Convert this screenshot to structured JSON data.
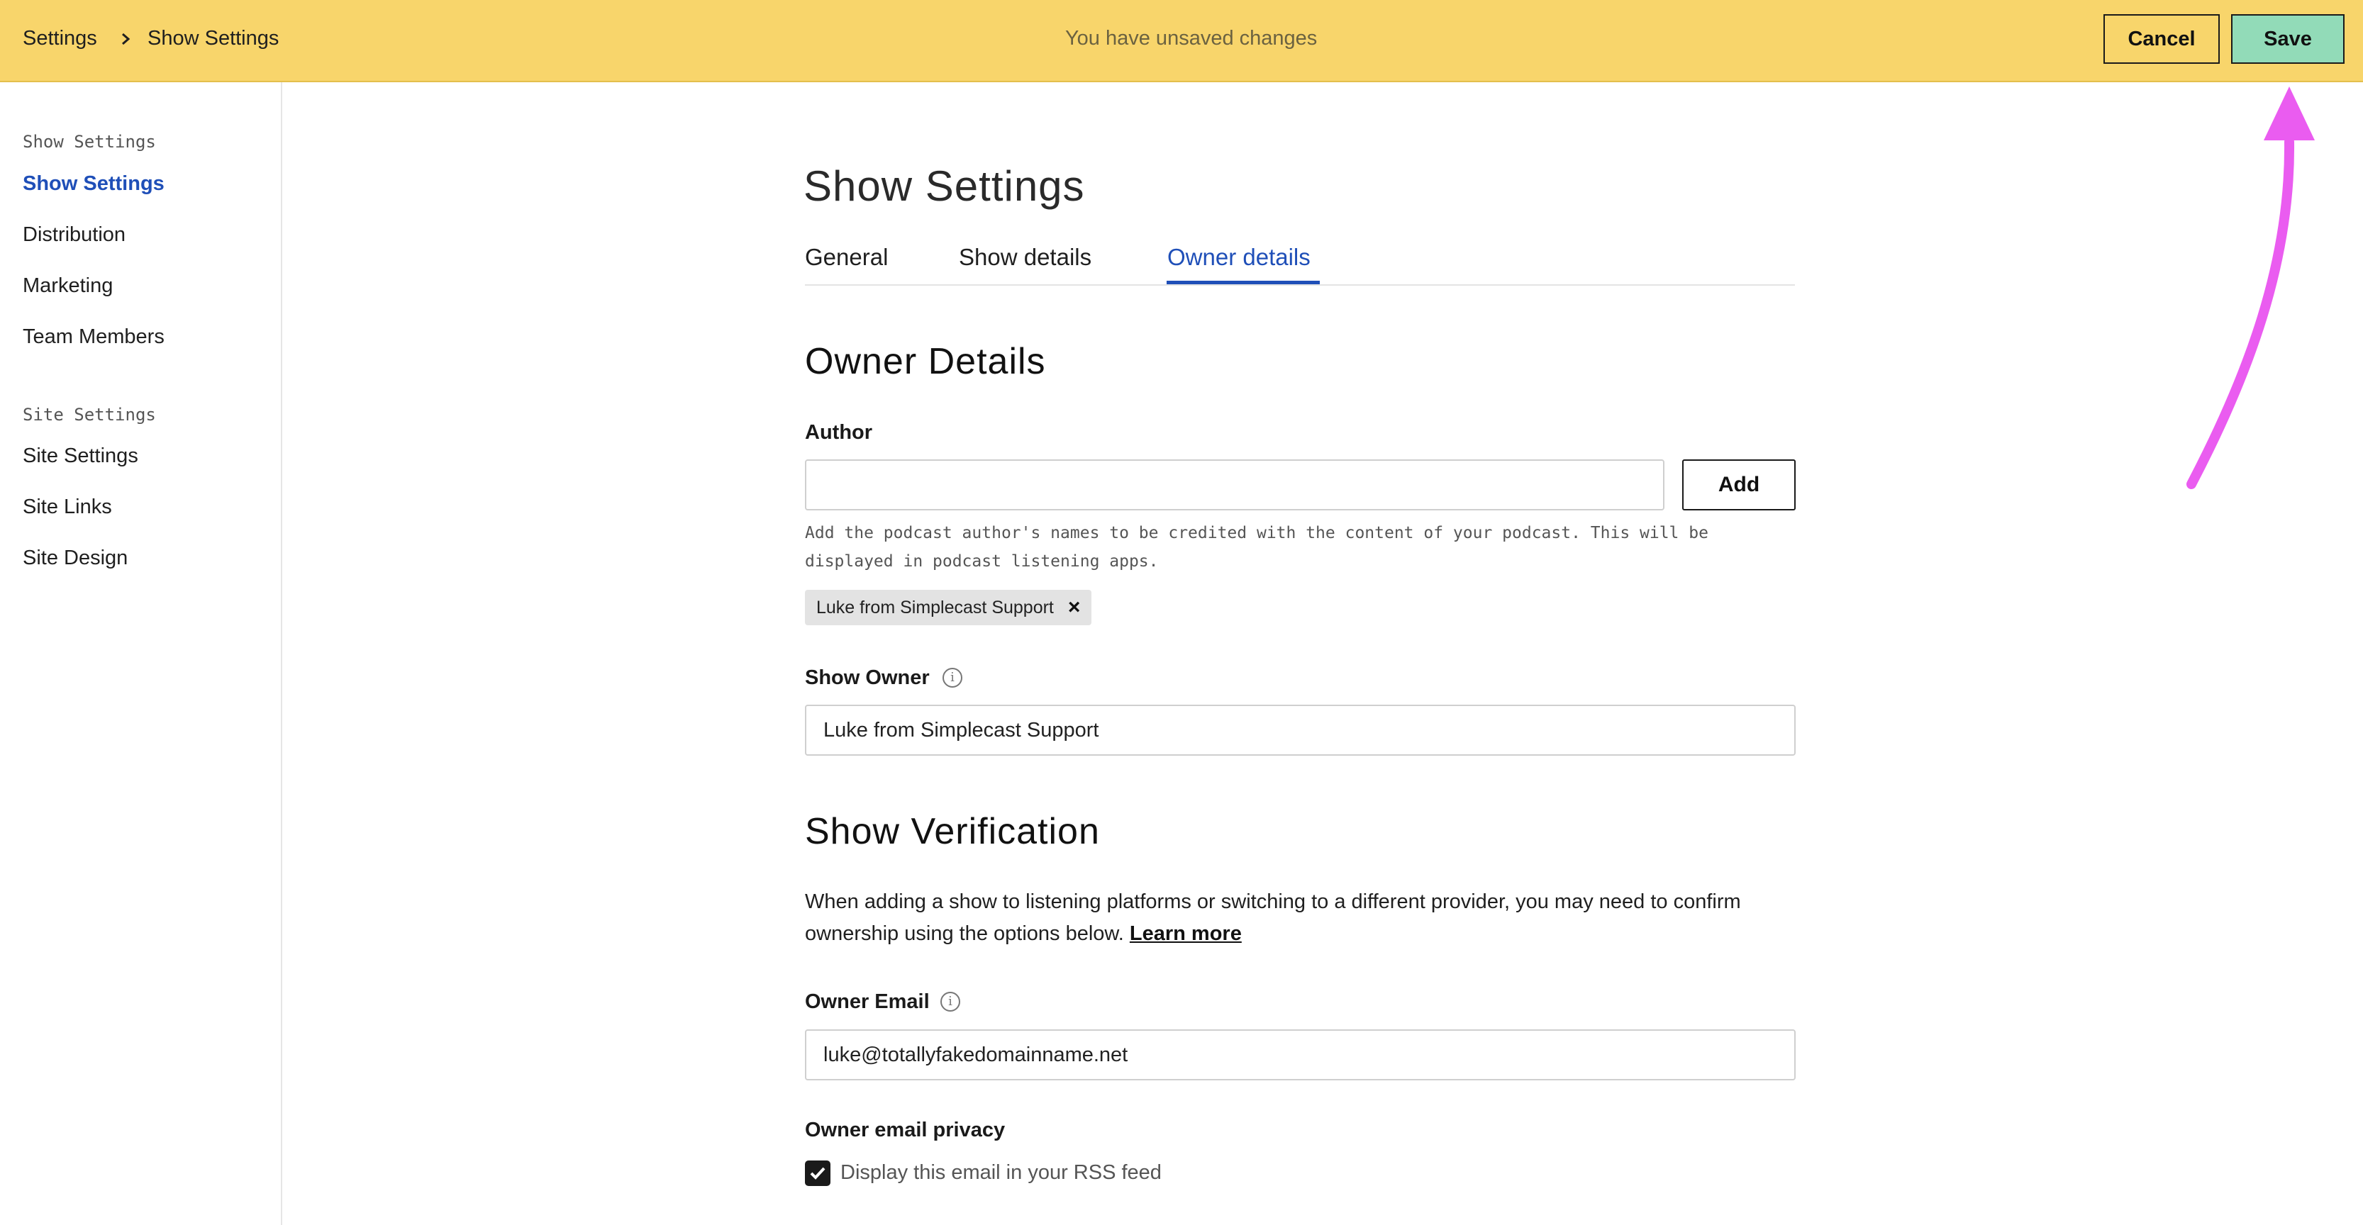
{
  "topbar": {
    "breadcrumb": [
      "Settings",
      "Show Settings"
    ],
    "status": "You have unsaved changes",
    "cancel_label": "Cancel",
    "save_label": "Save"
  },
  "sidebar": {
    "groups": [
      {
        "title": "Show Settings",
        "items": [
          "Show Settings",
          "Distribution",
          "Marketing",
          "Team Members"
        ]
      },
      {
        "title": "Site Settings",
        "items": [
          "Site Settings",
          "Site Links",
          "Site Design"
        ]
      }
    ],
    "active_item": "Show Settings"
  },
  "main": {
    "title": "Show Settings",
    "tabs": [
      "General",
      "Show details",
      "Owner details"
    ],
    "active_tab": "Owner details",
    "owner_details": {
      "heading": "Owner Details",
      "author_label": "Author",
      "author_value": "",
      "add_label": "Add",
      "author_help": "Add the podcast author's names to be credited with the content of your podcast. This will be displayed in podcast listening apps.",
      "author_chips": [
        "Luke from Simplecast Support"
      ],
      "show_owner_label": "Show Owner",
      "show_owner_value": "Luke from Simplecast Support"
    },
    "verification": {
      "heading": "Show Verification",
      "description": "When adding a show to listening platforms or switching to a different provider, you may need to confirm ownership using the options below.",
      "learn_more": "Learn more",
      "owner_email_label": "Owner Email",
      "owner_email_value": "luke@totallyfakedomainname.net",
      "privacy_label": "Owner email privacy",
      "privacy_checkbox_label": "Display this email in your RSS feed",
      "privacy_checked": true
    }
  },
  "colors": {
    "topbar": "#f8d56b",
    "save_button": "#92dbb8",
    "accent_blue": "#1f4fb8",
    "annotation_arrow": "#ea5cf0"
  },
  "icons": {
    "breadcrumb_separator": "chevron-right-icon",
    "info": "info-icon",
    "remove_chip": "close-icon",
    "checkbox": "checkmark-icon"
  }
}
